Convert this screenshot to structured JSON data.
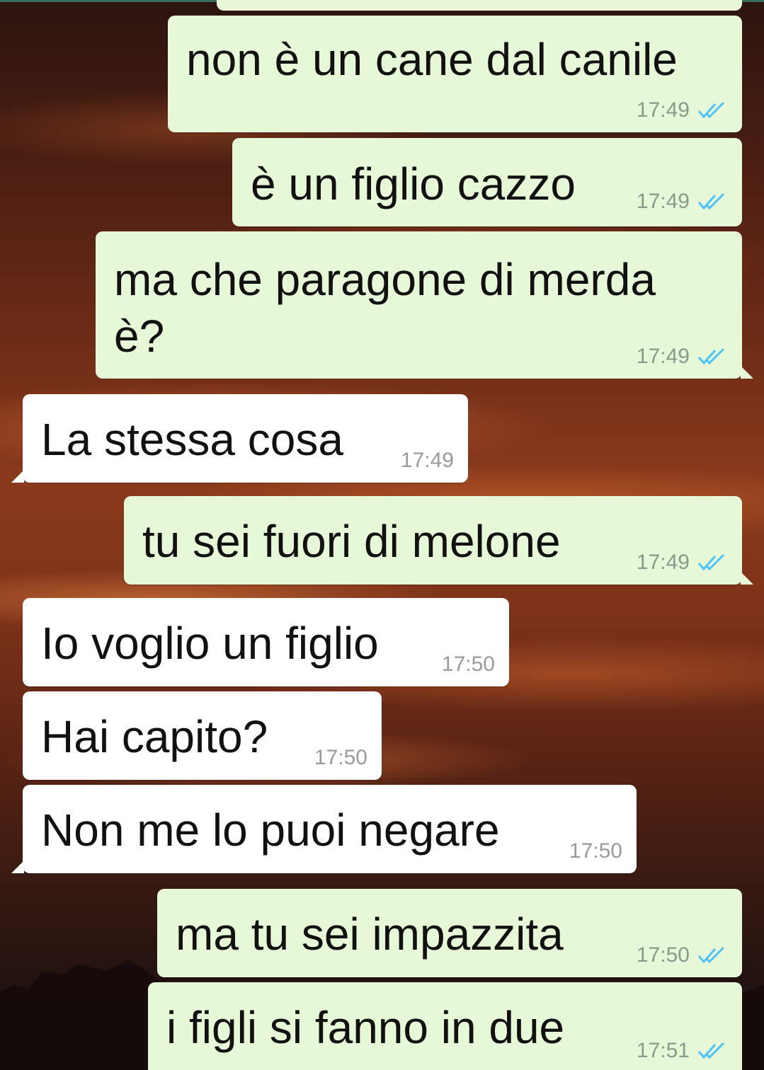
{
  "colors": {
    "outgoing_bubble": "#e7f8d9",
    "incoming_bubble": "#ffffff",
    "read_ticks": "#4fc3f7",
    "timestamp": "#8a9a8a"
  },
  "messages": [
    {
      "direction": "out",
      "text": "non è un cane dal canile",
      "time": "17:49",
      "status_icon": "double-check-icon"
    },
    {
      "direction": "out",
      "text": "è un figlio cazzo",
      "time": "17:49",
      "status_icon": "double-check-icon"
    },
    {
      "direction": "out",
      "text": "ma che paragone di merda\nè?",
      "time": "17:49",
      "status_icon": "double-check-icon"
    },
    {
      "direction": "in",
      "text": "La stessa cosa",
      "time": "17:49"
    },
    {
      "direction": "out",
      "text": "tu sei fuori di melone",
      "time": "17:49",
      "status_icon": "double-check-icon"
    },
    {
      "direction": "in",
      "text": "Io voglio un figlio",
      "time": "17:50"
    },
    {
      "direction": "in",
      "text": "Hai capito?",
      "time": "17:50"
    },
    {
      "direction": "in",
      "text": "Non me lo puoi negare",
      "time": "17:50"
    },
    {
      "direction": "out",
      "text": "ma tu sei impazzita",
      "time": "17:50",
      "status_icon": "double-check-icon"
    },
    {
      "direction": "out",
      "text": "i figli si fanno in due",
      "time": "17:51",
      "status_icon": "double-check-icon"
    }
  ]
}
